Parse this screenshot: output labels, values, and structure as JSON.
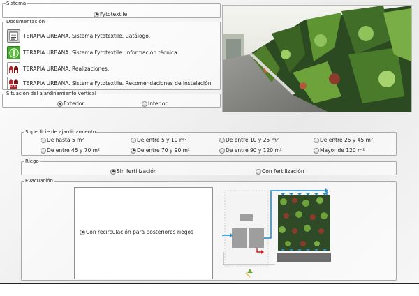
{
  "sistema": {
    "legend": "Sistema",
    "options": [
      {
        "label": "Fytotextile",
        "selected": true
      }
    ]
  },
  "documentacion": {
    "legend": "Documentación",
    "items": [
      {
        "label": "TERAPIA URBANA. Sistema Fytotextile. Catálogo.",
        "icon": "catalog-icon"
      },
      {
        "label": "TERAPIA URBANA. Sistema Fytotextile. Información técnica.",
        "icon": "info-icon"
      },
      {
        "label": "TERAPIA URBANA. Realizaciones.",
        "icon": "realizaciones-icon"
      },
      {
        "label": "TERAPIA URBANA. Sistema Fytotextile. Recomendaciones de instalación.",
        "icon": "pdf-icon"
      }
    ],
    "pdf_badge": "PDF"
  },
  "situacion": {
    "legend": "Situación del ajardinamiento vertical",
    "options": [
      {
        "label": "Exterior",
        "selected": true
      },
      {
        "label": "Interior",
        "selected": false
      }
    ]
  },
  "superficie": {
    "legend": "Superficie de ajardinamiento",
    "options": [
      {
        "label": "De hasta 5 m²",
        "selected": false
      },
      {
        "label": "De entre 5 y 10 m²",
        "selected": false
      },
      {
        "label": "De entre 10 y 25 m²",
        "selected": false
      },
      {
        "label": "De entre 25 y 45 m²",
        "selected": false
      },
      {
        "label": "De entre 45 y 70 m²",
        "selected": false
      },
      {
        "label": "De entre 70 y 90 m²",
        "selected": true
      },
      {
        "label": "De entre 90 y 120 m²",
        "selected": false
      },
      {
        "label": "Mayor de 120 m²",
        "selected": false
      }
    ]
  },
  "riego": {
    "legend": "Riego",
    "options": [
      {
        "label": "Sin fertilización",
        "selected": true
      },
      {
        "label": "Con fertilización",
        "selected": false
      }
    ]
  },
  "evacuacion": {
    "legend": "Evacuación",
    "options": [
      {
        "label": "Con recirculación para posteriores riegos",
        "selected": true
      }
    ]
  },
  "colors": {
    "water": "#1a8fd6",
    "tank": "#9e9e9e",
    "arrow_red": "#d21d1d",
    "plant_dark": "#2f4a26",
    "plant_light": "#6ea23a",
    "plant_red": "#8a3b2c"
  }
}
